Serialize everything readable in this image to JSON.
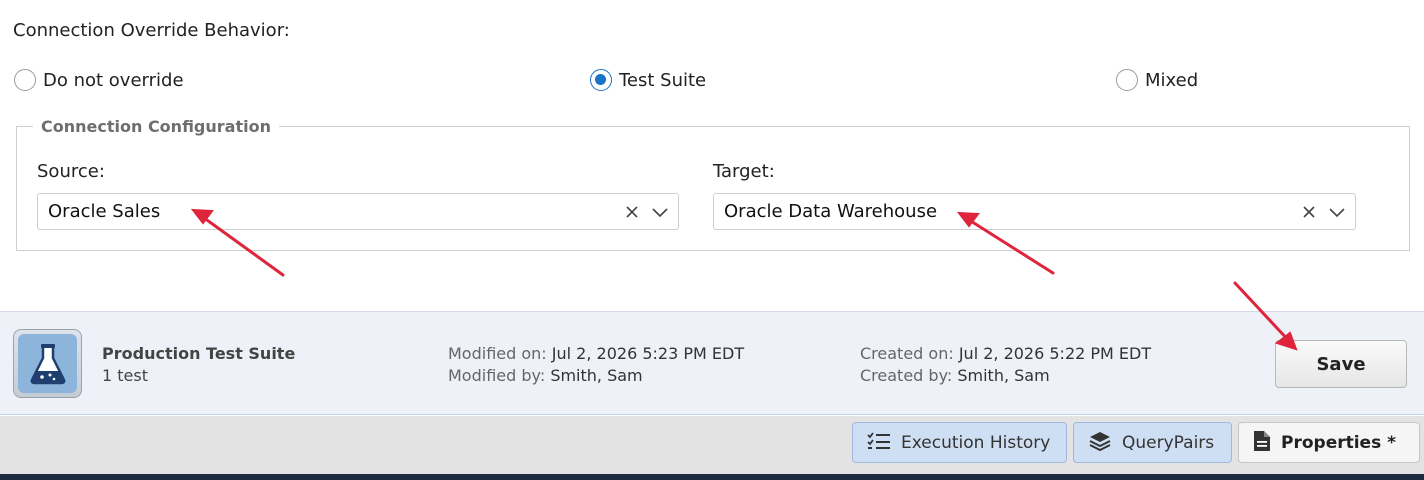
{
  "override": {
    "label": "Connection Override Behavior:",
    "options": [
      {
        "label": "Do not override",
        "selected": false
      },
      {
        "label": "Test Suite",
        "selected": true
      },
      {
        "label": "Mixed",
        "selected": false
      }
    ]
  },
  "connection_config": {
    "legend": "Connection Configuration",
    "source": {
      "label": "Source:",
      "value": "Oracle Sales"
    },
    "target": {
      "label": "Target:",
      "value": "Oracle Data Warehouse"
    }
  },
  "suite": {
    "name": "Production Test Suite",
    "count": "1 test",
    "icon": "flask-icon",
    "modified_on_label": "Modified on:",
    "modified_on": "Jul 2, 2026 5:23 PM EDT",
    "modified_by_label": "Modified by:",
    "modified_by": "Smith, Sam",
    "created_on_label": "Created on:",
    "created_on": "Jul 2, 2026 5:22 PM EDT",
    "created_by_label": "Created by:",
    "created_by": "Smith, Sam"
  },
  "save_label": "Save",
  "tabs": [
    {
      "label": "Execution History",
      "icon": "checklist-icon",
      "active": false
    },
    {
      "label": "QueryPairs",
      "icon": "layers-icon",
      "active": false
    },
    {
      "label": "Properties *",
      "icon": "document-icon",
      "active": true
    }
  ],
  "colors": {
    "accent": "#1a73c6",
    "arrow": "#e0243b",
    "footer_bg": "#eef1f8",
    "tab_bg": "#cfdff3"
  }
}
